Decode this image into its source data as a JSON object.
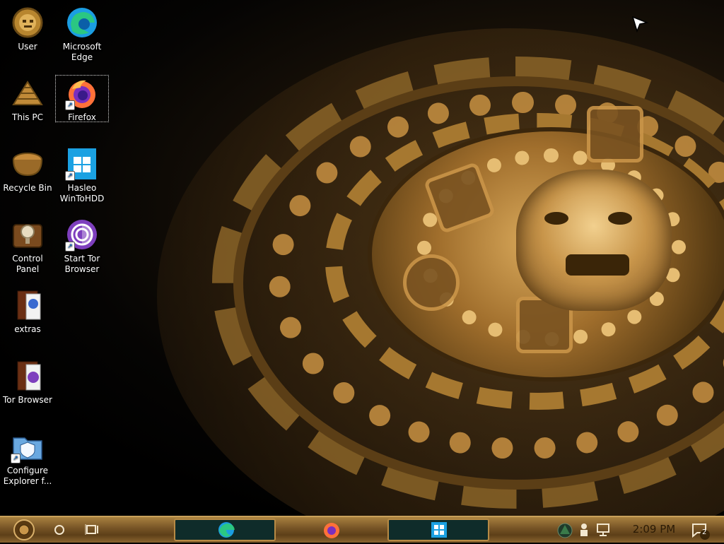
{
  "desktop_icons": [
    {
      "label": "User",
      "icon": "user-icon"
    },
    {
      "label": "Microsoft Edge",
      "icon": "edge-icon"
    },
    {
      "label": "This PC",
      "icon": "this-pc-icon"
    },
    {
      "label": "Firefox",
      "icon": "firefox-icon"
    },
    {
      "label": "Recycle Bin",
      "icon": "recycle-bin-icon"
    },
    {
      "label": "Hasleo WinToHDD",
      "icon": "wintohdd-icon"
    },
    {
      "label": "Control Panel",
      "icon": "control-panel-icon"
    },
    {
      "label": "Start Tor Browser",
      "icon": "tor-icon"
    },
    {
      "label": "extras",
      "icon": "folder-icon"
    },
    {
      "label": "Tor Browser",
      "icon": "folder-icon"
    },
    {
      "label": "Configure Explorer f...",
      "icon": "configure-icon"
    }
  ],
  "taskbar": {
    "start": "start-icon",
    "search": "search-icon",
    "task_view": "task-view-icon",
    "pinned": [
      "edge-icon",
      "firefox-icon",
      "windows-icon"
    ],
    "tray": [
      "tray-app-icon",
      "people-icon",
      "network-icon"
    ],
    "clock": "2:09 PM",
    "notifications_count": "2"
  },
  "colors": {
    "edge": "#1b9de2",
    "firefox": "#ff7139",
    "tor": "#7e3fbe",
    "windows": "#1ba1e2",
    "gold": "#c9a15a"
  }
}
